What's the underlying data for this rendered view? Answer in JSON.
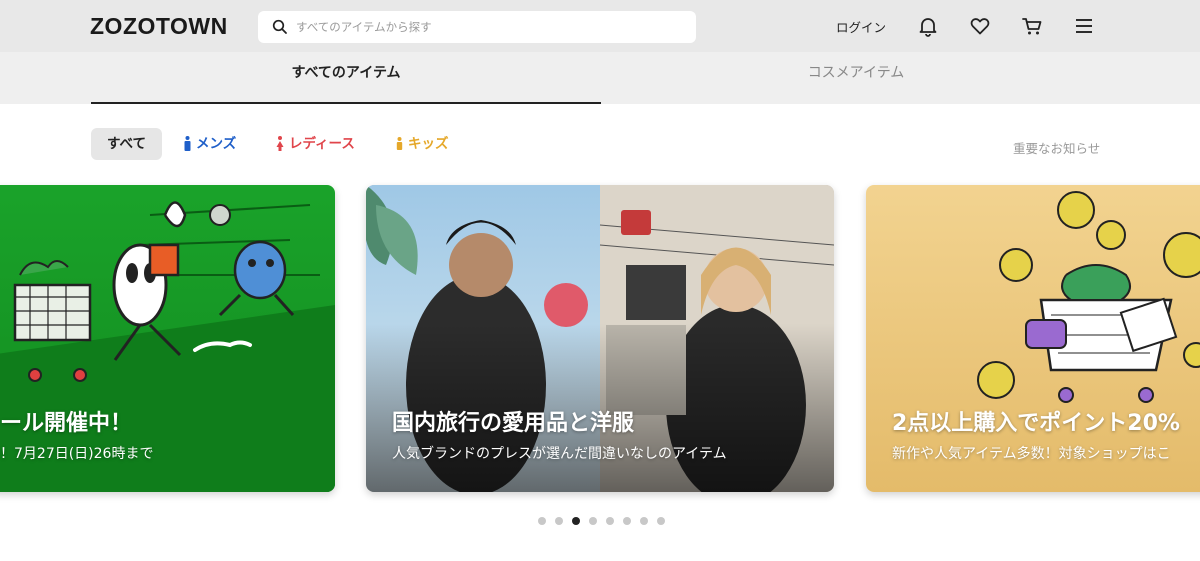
{
  "header": {
    "logo": "ZOZOTOWN",
    "search_placeholder": "すべてのアイテムから探す",
    "login_label": "ログイン",
    "icons": [
      "bell-icon",
      "heart-icon",
      "cart-icon",
      "menu-icon"
    ]
  },
  "tabs": [
    {
      "label": "すべてのアイテム",
      "active": true
    },
    {
      "label": "コスメアイテム",
      "active": false
    }
  ],
  "gender_filters": [
    {
      "label": "すべて",
      "selected": true,
      "color": "#222222"
    },
    {
      "label": "メンズ",
      "selected": false,
      "color": "#1f5fc9"
    },
    {
      "label": "レディース",
      "selected": false,
      "color": "#e0454b"
    },
    {
      "label": "キッズ",
      "selected": false,
      "color": "#e5a82a"
    }
  ],
  "notice_link": "重要なお知らせ",
  "banners": [
    {
      "title": "ール開催中！",
      "subtitle": "！7月27日(日)26時まで",
      "color": "#169a25"
    },
    {
      "title": "国内旅行の愛用品と洋服",
      "subtitle": "人気ブランドのプレスが選んだ間違いなしのアイテム",
      "color": "#c9c2b6"
    },
    {
      "title": "2点以上購入でポイント20%",
      "subtitle": "新作や人気アイテム多数！対象ショップはこ",
      "color": "#ebc77c"
    }
  ],
  "pagination": {
    "count": 8,
    "active_index": 2
  }
}
